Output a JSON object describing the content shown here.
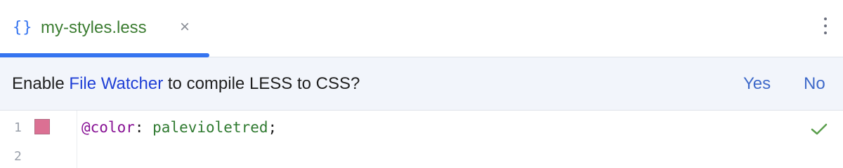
{
  "tab": {
    "icon": "{}",
    "label": "my-styles.less",
    "close": "×"
  },
  "banner": {
    "text_before": "Enable ",
    "link": "File Watcher",
    "text_after": " to compile LESS to CSS?",
    "yes": "Yes",
    "no": "No"
  },
  "editor": {
    "line_numbers": [
      "1",
      "2"
    ],
    "line1": {
      "variable": "@color",
      "colon": ": ",
      "value": "palevioletred",
      "semicolon": ";"
    },
    "swatch_color": "#db7093",
    "status": "check-icon"
  },
  "colors": {
    "accent": "#3574f0",
    "tab_label": "#3c7d32",
    "link": "#1f3fd6",
    "action": "#3e69c9",
    "check": "#5a9e4c"
  }
}
